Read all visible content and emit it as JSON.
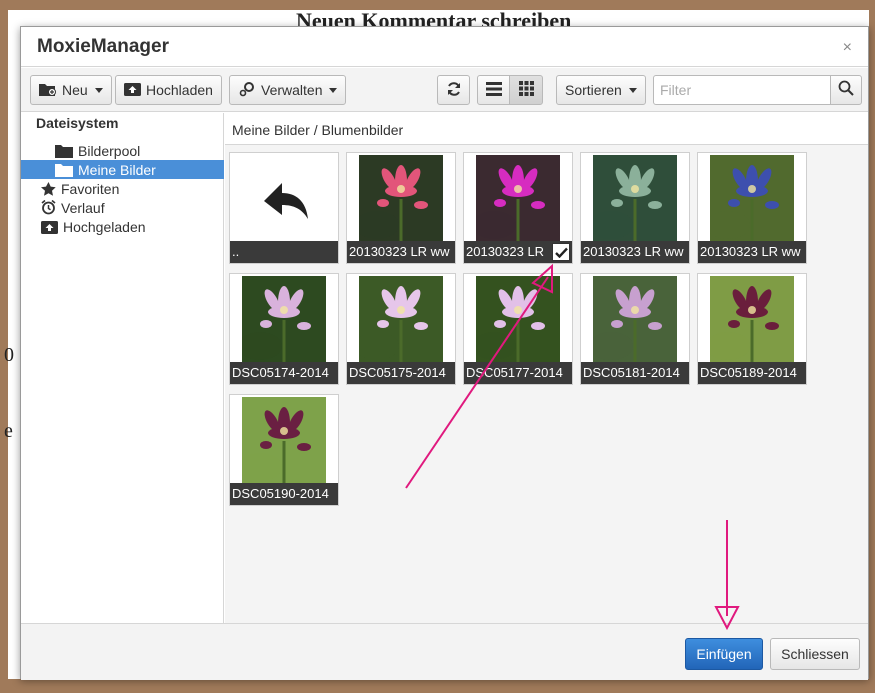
{
  "background": {
    "page_title": "Neuen Kommentar schreiben",
    "side_text_1": "0",
    "side_text_2": "e"
  },
  "dialog": {
    "title": "MoxieManager",
    "close_label": "×"
  },
  "toolbar": {
    "new_label": "Neu",
    "upload_label": "Hochladen",
    "manage_label": "Verwalten",
    "sort_label": "Sortieren",
    "filter_placeholder": "Filter"
  },
  "sidebar": {
    "root_label": "Dateisystem",
    "items": [
      {
        "label": "Bilderpool",
        "icon": "folder-icon"
      },
      {
        "label": "Meine Bilder",
        "icon": "folder-icon",
        "selected": true
      },
      {
        "label": "Favoriten",
        "icon": "star-icon"
      },
      {
        "label": "Verlauf",
        "icon": "alarm-clock-icon"
      },
      {
        "label": "Hochgeladen",
        "icon": "upload-icon"
      }
    ]
  },
  "content": {
    "breadcrumb": "Meine Bilder / Blumenbilder",
    "files": [
      {
        "label": "..",
        "kind": "up"
      },
      {
        "label": "20130323 LR ww",
        "kind": "image",
        "colors": [
          "#2c3a24",
          "#e2557a"
        ]
      },
      {
        "label": "20130323 LR",
        "kind": "image",
        "colors": [
          "#3b2a30",
          "#d62cc0"
        ],
        "checked": true
      },
      {
        "label": "20130323 LR ww",
        "kind": "image",
        "colors": [
          "#2f4e3a",
          "#8bb09a"
        ]
      },
      {
        "label": "20130323 LR ww",
        "kind": "image",
        "colors": [
          "#516a2e",
          "#3d4fae"
        ]
      },
      {
        "label": "DSC05174-2014",
        "kind": "image",
        "colors": [
          "#2d4a20",
          "#d9b2dc"
        ]
      },
      {
        "label": "DSC05175-2014",
        "kind": "image",
        "colors": [
          "#3c5a26",
          "#e6c6ea"
        ]
      },
      {
        "label": "DSC05177-2014",
        "kind": "image",
        "colors": [
          "#34521f",
          "#e2c0e8"
        ]
      },
      {
        "label": "DSC05181-2014",
        "kind": "image",
        "colors": [
          "#49633a",
          "#c7a0cf"
        ]
      },
      {
        "label": "DSC05189-2014",
        "kind": "image",
        "colors": [
          "#7f9c45",
          "#6a1e3c"
        ]
      },
      {
        "label": "DSC05190-2014",
        "kind": "image",
        "colors": [
          "#7ea24a",
          "#6a1f42"
        ]
      }
    ]
  },
  "footer": {
    "insert_label": "Einfügen",
    "close_label": "Schliessen"
  },
  "colors": {
    "accent": "#2b73c8",
    "selection": "#4a8fd8",
    "annotation_arrow": "#e0197e"
  }
}
